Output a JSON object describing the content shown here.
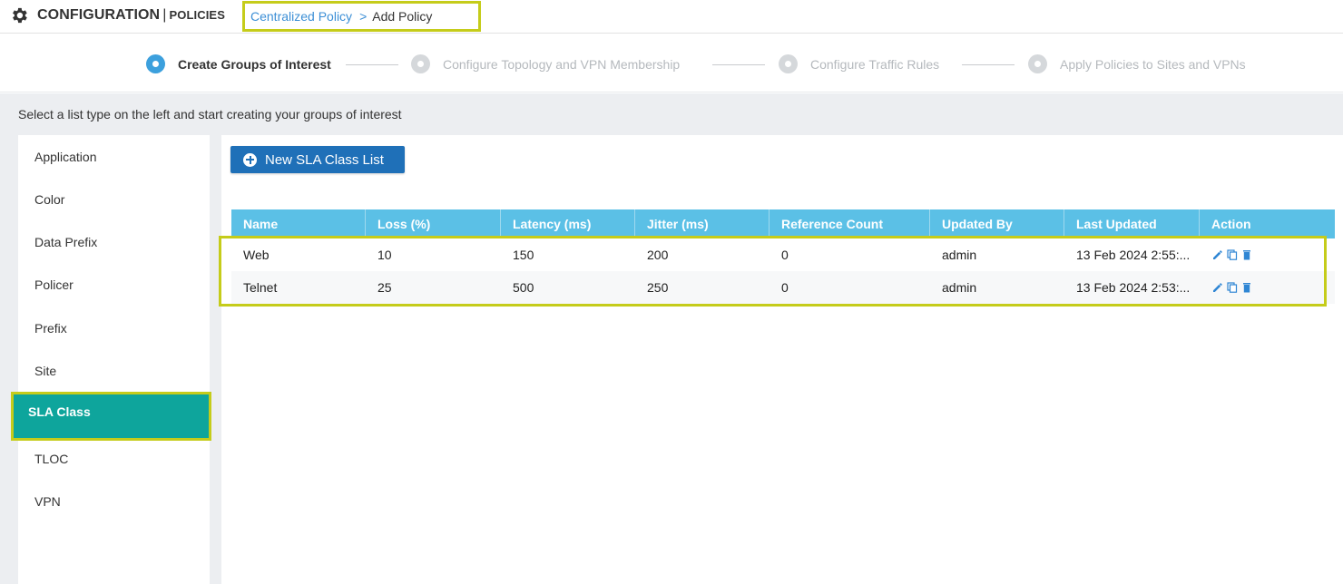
{
  "header": {
    "title": "CONFIGURATION",
    "separator": "|",
    "subtitle": "POLICIES",
    "breadcrumb": {
      "link": "Centralized Policy",
      "arrow": ">",
      "current": "Add Policy"
    }
  },
  "stepper": {
    "steps": [
      {
        "label": "Create Groups of Interest",
        "active": true
      },
      {
        "label": "Configure Topology and VPN Membership",
        "active": false
      },
      {
        "label": "Configure Traffic Rules",
        "active": false
      },
      {
        "label": "Apply Policies to Sites and VPNs",
        "active": false
      }
    ]
  },
  "instruction": "Select a list type on the left and start creating your groups of interest",
  "sidebar": {
    "items": [
      {
        "label": "Application"
      },
      {
        "label": "Color"
      },
      {
        "label": "Data Prefix"
      },
      {
        "label": "Policer"
      },
      {
        "label": "Prefix"
      },
      {
        "label": "Site"
      },
      {
        "label": "SLA Class",
        "selected": true
      },
      {
        "label": "TLOC"
      },
      {
        "label": "VPN"
      }
    ]
  },
  "main": {
    "new_button_label": "New SLA Class List",
    "table": {
      "headers": [
        "Name",
        "Loss (%)",
        "Latency (ms)",
        "Jitter (ms)",
        "Reference Count",
        "Updated By",
        "Last Updated",
        "Action"
      ],
      "rows": [
        [
          "Web",
          "10",
          "150",
          "200",
          "0",
          "admin",
          "13 Feb 2024 2:55:..."
        ],
        [
          "Telnet",
          "25",
          "500",
          "250",
          "0",
          "admin",
          "13 Feb 2024 2:53:..."
        ]
      ]
    }
  },
  "colors": {
    "accent_blue": "#1f70b8",
    "header_cyan": "#5bc0e6",
    "selected_teal": "#0ea59c",
    "highlight": "#c5cc1a",
    "link": "#3c8fd6"
  },
  "icons": [
    "gear-icon",
    "plus-circle-icon",
    "edit-icon",
    "copy-icon",
    "delete-icon"
  ]
}
